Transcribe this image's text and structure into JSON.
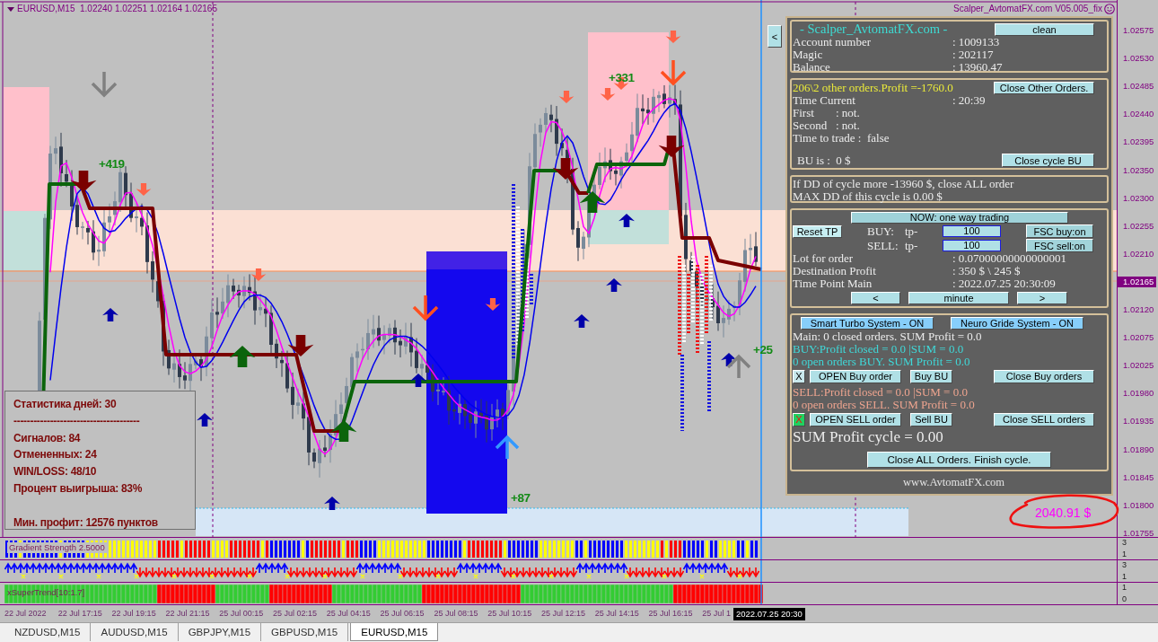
{
  "chart": {
    "symbol_line": "EURUSD,M15  1.02240 1.02251 1.02164 1.02165",
    "ea_title": "Scalper_AvtomatFX.com V05.005_fix",
    "signal_labels": [
      "+419",
      "+331",
      "+87",
      "+25"
    ],
    "balance_note": "2040.91 $",
    "price_axis": [
      {
        "text": "1.02575",
        "highlighted": false
      },
      {
        "text": "1.02530",
        "highlighted": false
      },
      {
        "text": "1.02485",
        "highlighted": false
      },
      {
        "text": "1.02440",
        "highlighted": false
      },
      {
        "text": "1.02395",
        "highlighted": false
      },
      {
        "text": "1.02350",
        "highlighted": false
      },
      {
        "text": "1.02300",
        "highlighted": false
      },
      {
        "text": "1.02255",
        "highlighted": false
      },
      {
        "text": "1.02210",
        "highlighted": false
      },
      {
        "text": "1.02165",
        "highlighted": true
      },
      {
        "text": "1.02120",
        "highlighted": false
      },
      {
        "text": "1.02075",
        "highlighted": false
      },
      {
        "text": "1.02025",
        "highlighted": false
      },
      {
        "text": "1.01980",
        "highlighted": false
      },
      {
        "text": "1.01935",
        "highlighted": false
      },
      {
        "text": "1.01890",
        "highlighted": false
      },
      {
        "text": "1.01845",
        "highlighted": false
      },
      {
        "text": "1.01800",
        "highlighted": false
      },
      {
        "text": "1.01755",
        "highlighted": false
      }
    ]
  },
  "stats": {
    "lines": [
      "Статистика дней: 30",
      "--------------------------------------",
      "Сигналов: 84",
      "Отмененных: 24",
      "WIN/LOSS: 48/10",
      "Процент выигрыша: 83%"
    ],
    "summary": "Мин. профит: 12576 пунктов"
  },
  "indicators": [
    {
      "kind": "bars",
      "label": "Gradient Strength 2.5000",
      "axis": [
        "3",
        "1"
      ]
    },
    {
      "kind": "arrows",
      "axis": [
        "3",
        "1"
      ]
    },
    {
      "kind": "blocks",
      "label": "xSuperTrend[10:1.7]",
      "axis": [
        "1",
        "0"
      ]
    }
  ],
  "time_axis": {
    "labels": [
      "22 Jul 2022",
      "22 Jul 17:15",
      "22 Jul 19:15",
      "22 Jul 21:15",
      "25 Jul 00:15",
      "25 Jul 02:15",
      "25 Jul 04:15",
      "25 Jul 06:15",
      "25 Jul 08:15",
      "25 Jul 10:15",
      "25 Jul 12:15",
      "25 Jul 14:15",
      "25 Jul 16:15",
      "25 Jul 1"
    ],
    "cursor": "2022.07.25 20:30"
  },
  "panel": {
    "collapse": "<",
    "account": {
      "title": "- Scalper_AvtomatFX.com -",
      "button": "clean",
      "rows": [
        {
          "label": "Account number",
          "value": ": 1009133"
        },
        {
          "label": "Magic",
          "value": ": 202117"
        },
        {
          "label": "Balance",
          "value": ": 13960.47"
        }
      ]
    },
    "orders": {
      "summary": "206\\2 other orders.Profit =-1760.0",
      "button": "Close Other Orders.",
      "rows": [
        {
          "label": "Time Current",
          "value": ": 20:39"
        }
      ],
      "checks": [
        {
          "label": "First",
          "value": ": not."
        },
        {
          "label": "Second",
          "value": ": not."
        }
      ],
      "trade_line": "Time to trade :  false",
      "bu": "BU is :  0 $",
      "bu_button": "Close cycle BU"
    },
    "drawdown": [
      "If DD of cycle more -13960 $, close ALL order",
      "MAX DD of this cycle is 0.00 $"
    ],
    "trading": {
      "mode": "NOW: one way trading",
      "reset_button": "Reset TP",
      "sides": [
        {
          "side": "BUY:",
          "tp": "tp-",
          "value": "100",
          "button": "FSC buy:on"
        },
        {
          "side": "SELL:",
          "tp": "tp-",
          "value": "100",
          "button": "FSC sell:on"
        }
      ],
      "rows": [
        {
          "label": "Lot for order",
          "value": ": 0.07000000000000001"
        },
        {
          "label": "Destination Profit",
          "value": ": 350 $ \\ 245 $"
        },
        {
          "label": "Time Point Main",
          "value": ": 2022.07.25 20:30:09"
        }
      ],
      "nav": [
        "<",
        "minute",
        ">"
      ]
    },
    "systems": {
      "toggles": [
        "Smart Turbo System - ON",
        "Neuro Gride System - ON"
      ],
      "main": "Main: 0 closed orders. SUM Profit = 0.0",
      "sides": [
        {
          "kind": "buy",
          "lines": [
            "BUY:Profit closed = 0.0 |SUM = 0.0",
            "0 open orders BUY. SUM Profit = 0.0"
          ],
          "x_button": {
            "label": "X",
            "active": false
          },
          "buttons": [
            "OPEN Buy order",
            "Buy BU",
            "Close Buy orders"
          ]
        },
        {
          "kind": "sell",
          "lines": [
            "SELL:Profit closed = 0.0 |SUM = 0.0",
            "0 open orders SELL. SUM Profit = 0.0"
          ],
          "x_button": {
            "label": "X",
            "active": true
          },
          "buttons": [
            "OPEN SELL order",
            "Sell BU",
            "Close SELL orders"
          ]
        }
      ],
      "total": "SUM Profit cycle = 0.00",
      "close_all": "Close ALL Orders. Finish cycle."
    },
    "footer": "www.AvtomatFX.com"
  },
  "tabs": [
    {
      "label": "NZDUSD,M15",
      "selected": false
    },
    {
      "label": "AUDUSD,M15",
      "selected": false
    },
    {
      "label": "GBPJPY,M15",
      "selected": false
    },
    {
      "label": "GBPUSD,M15",
      "selected": false
    },
    {
      "label": "EURUSD,M15",
      "selected": true
    }
  ]
}
